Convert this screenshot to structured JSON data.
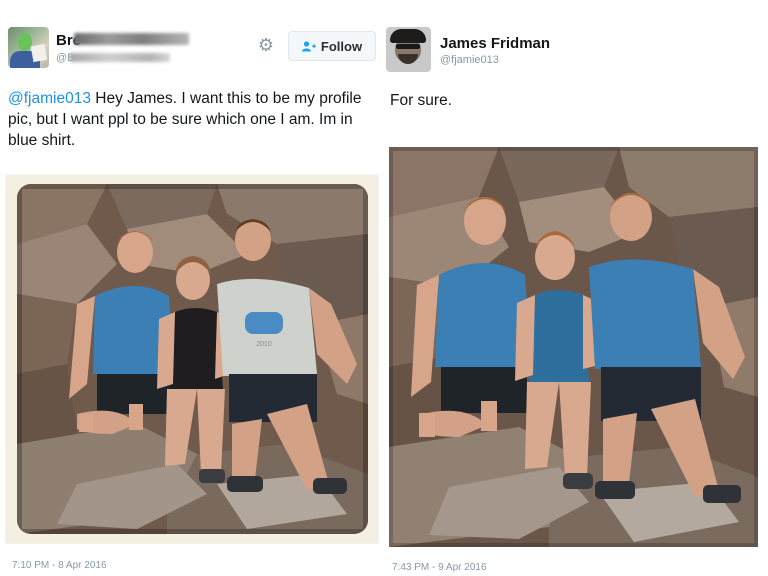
{
  "left_tweet": {
    "name_prefix": "Bre",
    "handle_prefix": "@B",
    "follow_label": "Follow",
    "mention": "@fjamie013",
    "text": " Hey James. I want this to be my profile pic, but I want ppl to be sure which one I am. Im in blue shirt.",
    "timestamp": "7:10 PM - 8 Apr 2016",
    "shirt_print": "2010"
  },
  "right_tweet": {
    "name": "James Fridman",
    "handle": "@fjamie013",
    "text": "For sure.",
    "timestamp": "7:43 PM - 9 Apr 2016"
  },
  "icons": {
    "settings": "gear-icon",
    "follow": "add-user-icon"
  },
  "colors": {
    "link": "#1b95e0",
    "secondary_text": "#8899a6",
    "blue_shirt": "#3b7fb4",
    "grey_shirt": "#cfd1cc"
  }
}
